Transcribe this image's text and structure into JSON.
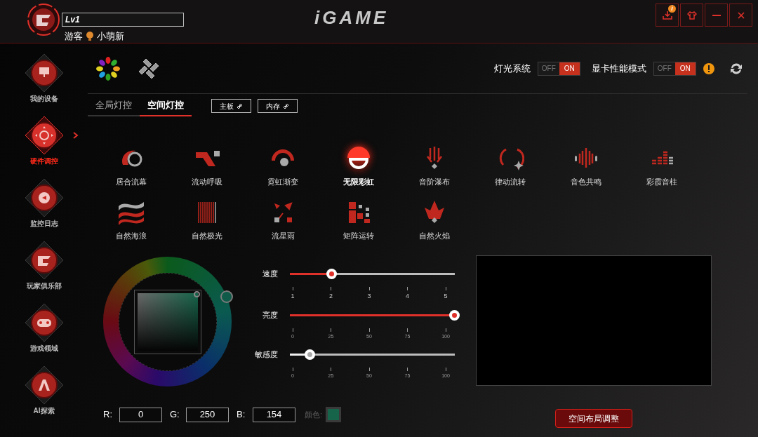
{
  "header": {
    "level": "Lv1",
    "role": "游客",
    "rank": "小萌新",
    "logo": "iGAME"
  },
  "window_buttons": [
    {
      "kind": "download",
      "badge": "i"
    },
    {
      "kind": "skin"
    },
    {
      "kind": "minimize"
    },
    {
      "kind": "close"
    }
  ],
  "sidebar": {
    "items": [
      {
        "label": "我的设备",
        "selected": false
      },
      {
        "label": "硬件调控",
        "selected": true
      },
      {
        "label": "监控日志",
        "selected": false
      },
      {
        "label": "玩家俱乐部",
        "selected": false
      },
      {
        "label": "游戏领域",
        "selected": false
      },
      {
        "label": "AI探索",
        "selected": false
      }
    ]
  },
  "modes": [
    {
      "selected": true
    },
    {
      "selected": false
    }
  ],
  "toggles": [
    {
      "label": "灯光系统",
      "off_label": "OFF",
      "on_label": "ON",
      "on": true,
      "warning": false
    },
    {
      "label": "显卡性能模式",
      "off_label": "OFF",
      "on_label": "ON",
      "on": true,
      "warning": true
    }
  ],
  "tabs": [
    {
      "label": "全局灯控",
      "selected": false
    },
    {
      "label": "空间灯控",
      "selected": true
    }
  ],
  "device_buttons": [
    "主板",
    "内存"
  ],
  "effects": [
    {
      "label": "居合流幕",
      "selected": false
    },
    {
      "label": "流动呼吸",
      "selected": false
    },
    {
      "label": "霓虹渐变",
      "selected": false
    },
    {
      "label": "无限彩虹",
      "selected": true
    },
    {
      "label": "音阶瀑布",
      "selected": false
    },
    {
      "label": "律动流转",
      "selected": false
    },
    {
      "label": "音色共鸣",
      "selected": false
    },
    {
      "label": "彩霞音柱",
      "selected": false
    },
    {
      "label": "自然海浪",
      "selected": false
    },
    {
      "label": "自然极光",
      "selected": false
    },
    {
      "label": "流星雨",
      "selected": false
    },
    {
      "label": "矩阵运转",
      "selected": false
    },
    {
      "label": "自然火焰",
      "selected": false
    }
  ],
  "sliders": [
    {
      "label": "速度",
      "level": 0.25,
      "disabled": false,
      "ticks": [
        "1",
        "2",
        "3",
        "4",
        "5"
      ]
    },
    {
      "label": "亮度",
      "level": 1,
      "disabled": false,
      "ticks": [
        "0",
        "25",
        "50",
        "75",
        "100"
      ]
    },
    {
      "label": "敏感度",
      "level": 0.12,
      "disabled": true,
      "ticks": [
        "0",
        "25",
        "50",
        "75",
        "100"
      ]
    }
  ],
  "rgb": [
    {
      "label": "R:",
      "value": "0"
    },
    {
      "label": "G:",
      "value": "250"
    },
    {
      "label": "B:",
      "value": "154"
    }
  ],
  "swatch": {
    "label": "颜色:",
    "color": "#16654a"
  },
  "layout_button": "空间布局调整"
}
